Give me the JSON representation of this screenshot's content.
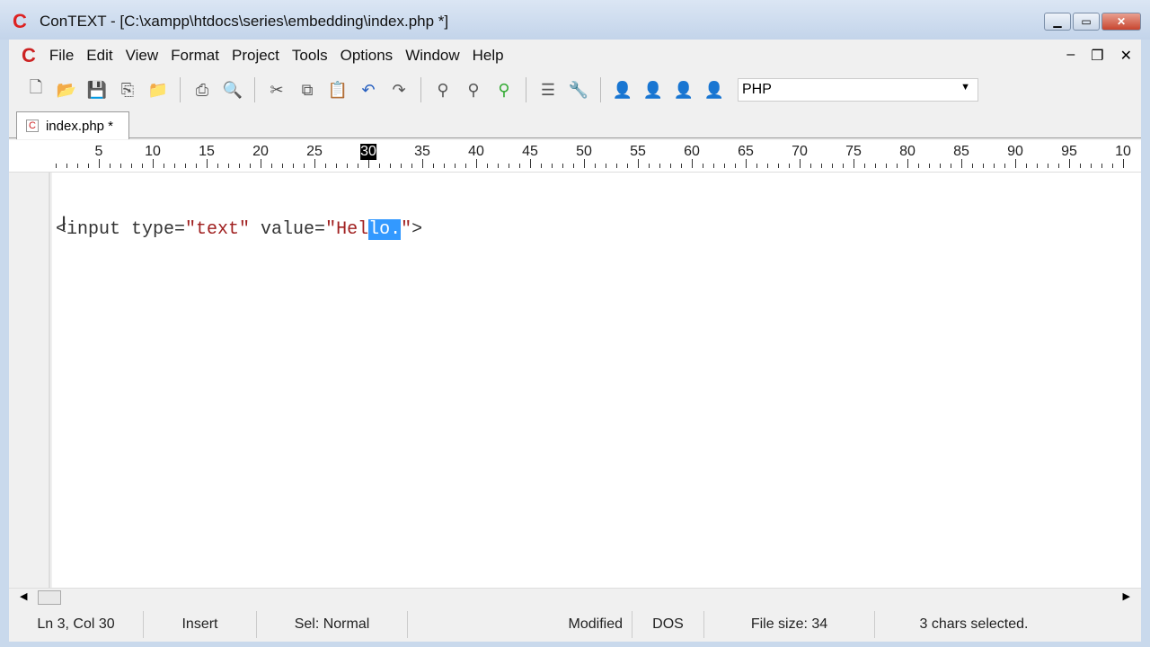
{
  "window": {
    "title": "ConTEXT - [C:\\xampp\\htdocs\\series\\embedding\\index.php *]",
    "logo": "C"
  },
  "menu": [
    "File",
    "Edit",
    "View",
    "Format",
    "Project",
    "Tools",
    "Options",
    "Window",
    "Help"
  ],
  "toolbar": {
    "language": "PHP"
  },
  "tabs": [
    {
      "label": "index.php *"
    }
  ],
  "ruler": {
    "labels": [
      "5",
      "10",
      "15",
      "20",
      "25",
      "30",
      "35",
      "40",
      "45",
      "50",
      "55",
      "60",
      "65",
      "70",
      "75",
      "80",
      "85",
      "90",
      "95",
      "10"
    ],
    "current_column": 30
  },
  "editor": {
    "line3": {
      "tag_open": "<input type=",
      "s1": "\"text\"",
      "mid": " value=",
      "q": "\"",
      "pre_sel": "Hel",
      "selected": "lo.",
      "post": "\"",
      "close": ">"
    }
  },
  "status": {
    "position": "Ln 3, Col 30",
    "mode": "Insert",
    "sel": "Sel: Normal",
    "modified": "Modified",
    "format": "DOS",
    "size": "File size: 34",
    "selection": "3 chars selected."
  }
}
